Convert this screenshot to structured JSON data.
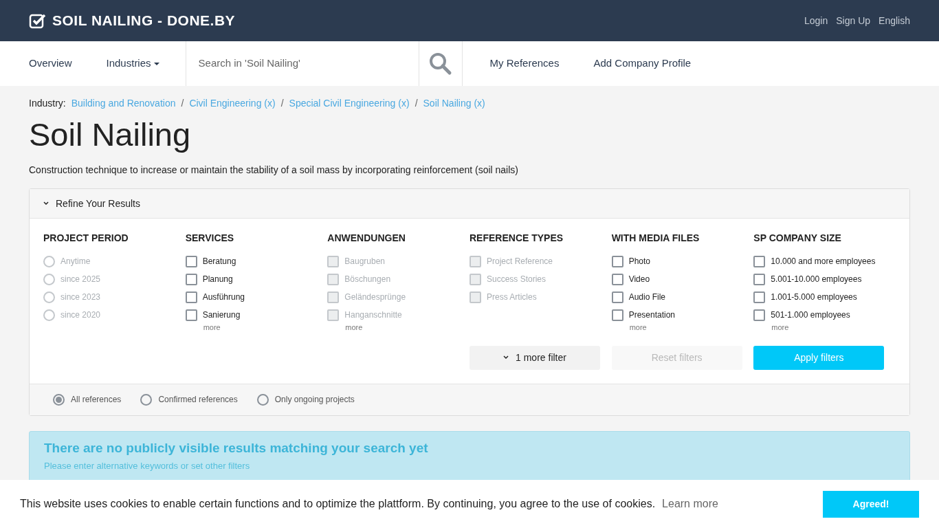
{
  "header": {
    "brand": "SOIL NAILING - DONE.BY",
    "links": [
      "Login",
      "Sign Up",
      "English"
    ]
  },
  "nav": {
    "items": [
      {
        "label": "Overview",
        "dropdown": false
      },
      {
        "label": "Industries",
        "dropdown": true
      }
    ],
    "search": {
      "placeholder": "Search in 'Soil Nailing'"
    },
    "links": [
      "My References",
      "Add Company Profile"
    ]
  },
  "breadcrumb": {
    "label": "Industry:",
    "separator": "/",
    "items": [
      "Building and Renovation",
      "Civil Engineering (x)",
      "Special Civil Engineering (x)",
      "Soil Nailing (x)"
    ]
  },
  "title": "Soil Nailing",
  "description": "Construction technique to increase or maintain the stability of a soil mass by incorporating reinforcement (soil nails)",
  "refine": {
    "label": "Refine Your Results",
    "expanded": true,
    "groups": [
      {
        "title": "PROJECT PERIOD",
        "kind": "radio",
        "options": [
          {
            "label": "Anytime",
            "disabled": true,
            "checked": false
          },
          {
            "label": "since 2025",
            "disabled": true,
            "checked": false
          },
          {
            "label": "since 2023",
            "disabled": true,
            "checked": false
          },
          {
            "label": "since 2020",
            "disabled": true,
            "checked": false
          }
        ]
      },
      {
        "title": "SERVICES",
        "kind": "checkbox",
        "more": "more",
        "options": [
          {
            "label": "Beratung",
            "disabled": false,
            "checked": false
          },
          {
            "label": "Planung",
            "disabled": false,
            "checked": false
          },
          {
            "label": "Ausführung",
            "disabled": false,
            "checked": false
          },
          {
            "label": "Sanierung",
            "disabled": false,
            "checked": false
          }
        ]
      },
      {
        "title": "ANWENDUNGEN",
        "kind": "checkbox",
        "more": "more",
        "options": [
          {
            "label": "Baugruben",
            "disabled": true,
            "checked": false
          },
          {
            "label": "Böschungen",
            "disabled": true,
            "checked": false
          },
          {
            "label": "Geländesprünge",
            "disabled": true,
            "checked": false
          },
          {
            "label": "Hanganschnitte",
            "disabled": true,
            "checked": false
          }
        ]
      },
      {
        "title": "REFERENCE TYPES",
        "kind": "checkbox",
        "options": [
          {
            "label": "Project Reference",
            "disabled": true,
            "checked": false
          },
          {
            "label": "Success Stories",
            "disabled": true,
            "checked": false
          },
          {
            "label": "Press Articles",
            "disabled": true,
            "checked": false
          }
        ]
      },
      {
        "title": "WITH MEDIA FILES",
        "kind": "checkbox",
        "more": "more",
        "options": [
          {
            "label": "Photo",
            "disabled": false,
            "checked": false
          },
          {
            "label": "Video",
            "disabled": false,
            "checked": false
          },
          {
            "label": "Audio File",
            "disabled": false,
            "checked": false
          },
          {
            "label": "Presentation",
            "disabled": false,
            "checked": false
          }
        ]
      },
      {
        "title": "SP COMPANY SIZE",
        "kind": "checkbox",
        "more": "more",
        "options": [
          {
            "label": "10.000 and more employees",
            "disabled": false,
            "checked": false
          },
          {
            "label": "5.001-10.000 employees",
            "disabled": false,
            "checked": false
          },
          {
            "label": "1.001-5.000 employees",
            "disabled": false,
            "checked": false
          },
          {
            "label": "501-1.000 employees",
            "disabled": false,
            "checked": false
          }
        ]
      }
    ],
    "buttons": [
      {
        "label": "1 more filter",
        "kind": "more"
      },
      {
        "label": "Reset filters",
        "kind": "reset",
        "disabled": true
      },
      {
        "label": "Apply filters",
        "kind": "apply"
      }
    ],
    "scope": [
      {
        "label": "All references",
        "selected": true
      },
      {
        "label": "Confirmed references",
        "selected": false
      },
      {
        "label": "Only ongoing projects",
        "selected": false
      }
    ]
  },
  "notice": {
    "title": "There are no publicly visible results matching your search yet",
    "text": "Please enter alternative keywords or set other filters"
  },
  "cookie": {
    "text": "This website uses cookies to enable certain functions and to optimize the plattform. By continuing, you agree to the use of cookies.",
    "link": "Learn more",
    "button": "Agreed!"
  }
}
